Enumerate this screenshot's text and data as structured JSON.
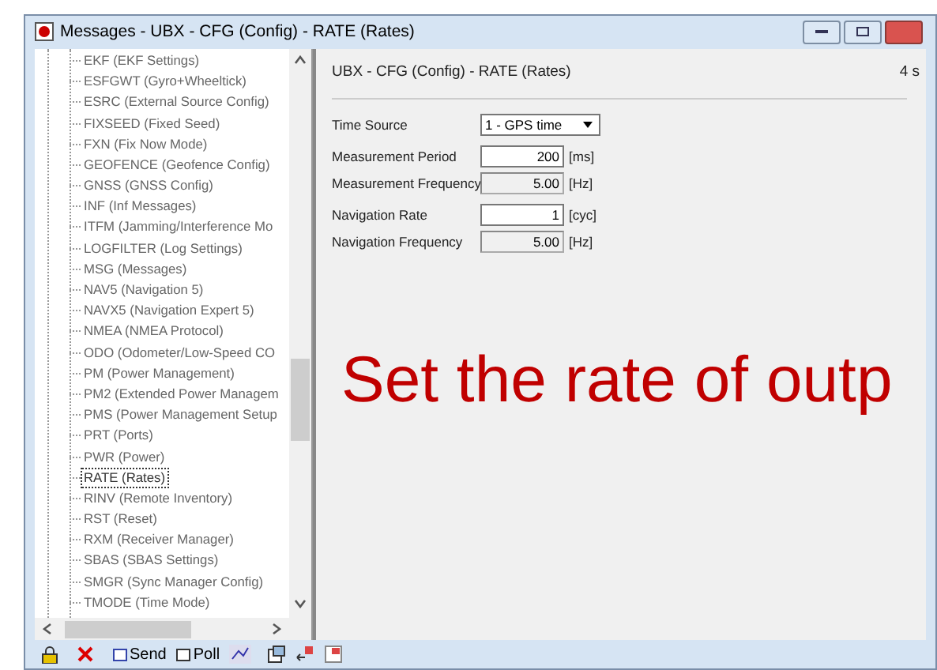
{
  "window": {
    "title": "Messages - UBX - CFG (Config) - RATE (Rates)"
  },
  "tree": {
    "items": [
      {
        "label": "EKF (EKF Settings)",
        "selected": false
      },
      {
        "label": "ESFGWT (Gyro+Wheeltick)",
        "selected": false
      },
      {
        "label": "ESRC (External Source Config)",
        "selected": false
      },
      {
        "label": "FIXSEED (Fixed Seed)",
        "selected": false
      },
      {
        "label": "FXN (Fix Now Mode)",
        "selected": false
      },
      {
        "label": "GEOFENCE (Geofence Config)",
        "selected": false
      },
      {
        "label": "GNSS (GNSS Config)",
        "selected": false
      },
      {
        "label": "INF (Inf Messages)",
        "selected": false
      },
      {
        "label": "ITFM (Jamming/Interference Mo",
        "selected": false
      },
      {
        "label": "LOGFILTER (Log Settings)",
        "selected": false
      },
      {
        "label": "MSG (Messages)",
        "selected": false
      },
      {
        "label": "NAV5 (Navigation 5)",
        "selected": false
      },
      {
        "label": "NAVX5 (Navigation Expert 5)",
        "selected": false
      },
      {
        "label": "NMEA (NMEA Protocol)",
        "selected": false
      },
      {
        "label": "ODO (Odometer/Low-Speed CO",
        "selected": false
      },
      {
        "label": "PM (Power Management)",
        "selected": false
      },
      {
        "label": "PM2 (Extended Power Managem",
        "selected": false
      },
      {
        "label": "PMS (Power Management Setup",
        "selected": false
      },
      {
        "label": "PRT (Ports)",
        "selected": false
      },
      {
        "label": "PWR (Power)",
        "selected": false
      },
      {
        "label": "RATE (Rates)",
        "selected": true
      },
      {
        "label": "RINV (Remote Inventory)",
        "selected": false
      },
      {
        "label": "RST (Reset)",
        "selected": false
      },
      {
        "label": "RXM (Receiver Manager)",
        "selected": false
      },
      {
        "label": "SBAS (SBAS Settings)",
        "selected": false
      },
      {
        "label": "SMGR (Sync Manager Config)",
        "selected": false
      },
      {
        "label": "TMODE (Time Mode)",
        "selected": false
      }
    ]
  },
  "panel": {
    "heading": "UBX - CFG (Config) - RATE (Rates)",
    "heading_right": "4 s",
    "fields": [
      {
        "kind": "dropdown",
        "label": "Time Source",
        "value": "1 - GPS time"
      },
      {
        "kind": "input",
        "label": "Measurement Period",
        "value": "200",
        "unit": "[ms]"
      },
      {
        "kind": "readonly",
        "label": "Measurement Frequency",
        "value": "5.00",
        "unit": "[Hz]"
      },
      {
        "kind": "input",
        "label": "Navigation Rate",
        "value": "1",
        "unit": "[cyc]"
      },
      {
        "kind": "readonly",
        "label": "Navigation Frequency",
        "value": "5.00",
        "unit": "[Hz]"
      }
    ],
    "overlay_text": "Set the rate of outp"
  },
  "toolbar": {
    "send": "Send",
    "poll": "Poll"
  }
}
